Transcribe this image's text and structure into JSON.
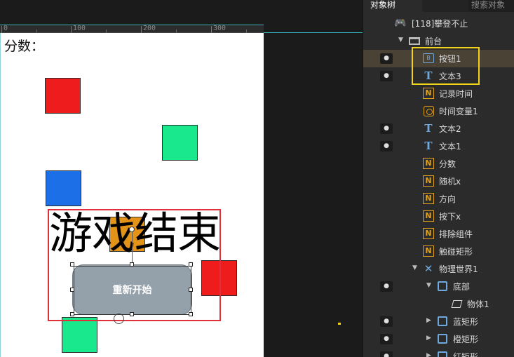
{
  "panel": {
    "tab_active": "对象树",
    "tab_search": "搜索对象",
    "tree": [
      {
        "label": "[118]攀登不止",
        "icon": "gamepad-icon",
        "eye": false,
        "arrow": ""
      },
      {
        "label": "前台",
        "icon": "stage-icon",
        "eye": false,
        "arrow": "▼"
      },
      {
        "label": "按钮1",
        "icon": "button-icon",
        "eye": true,
        "arrow": "",
        "highlighted": true
      },
      {
        "label": "文本3",
        "icon": "text-icon",
        "eye": true,
        "arrow": ""
      },
      {
        "label": "记录时间",
        "icon": "variable-icon",
        "eye": false,
        "arrow": ""
      },
      {
        "label": "时间变量1",
        "icon": "timer-icon",
        "eye": false,
        "arrow": ""
      },
      {
        "label": "文本2",
        "icon": "text-icon",
        "eye": true,
        "arrow": ""
      },
      {
        "label": "文本1",
        "icon": "text-icon",
        "eye": true,
        "arrow": ""
      },
      {
        "label": "分数",
        "icon": "variable-icon",
        "eye": false,
        "arrow": ""
      },
      {
        "label": "随机x",
        "icon": "variable-icon",
        "eye": false,
        "arrow": ""
      },
      {
        "label": "方向",
        "icon": "variable-icon",
        "eye": false,
        "arrow": ""
      },
      {
        "label": "按下x",
        "icon": "variable-icon",
        "eye": false,
        "arrow": ""
      },
      {
        "label": "排除组件",
        "icon": "variable-icon",
        "eye": false,
        "arrow": ""
      },
      {
        "label": "触碰矩形",
        "icon": "variable-icon",
        "eye": false,
        "arrow": ""
      },
      {
        "label": "物理世界1",
        "icon": "physics-icon",
        "eye": false,
        "arrow": "▼"
      },
      {
        "label": "底部",
        "icon": "layer-icon",
        "eye": true,
        "arrow": "▼"
      },
      {
        "label": "物体1",
        "icon": "body-icon",
        "eye": false,
        "arrow": ""
      },
      {
        "label": "蓝矩形",
        "icon": "layer-icon",
        "eye": true,
        "arrow": "▶"
      },
      {
        "label": "橙矩形",
        "icon": "layer-icon",
        "eye": true,
        "arrow": "▶"
      },
      {
        "label": "红矩形",
        "icon": "layer-icon",
        "eye": true,
        "arrow": "▶"
      }
    ]
  },
  "stage": {
    "ruler_labels": [
      "0",
      "100",
      "200",
      "300"
    ],
    "score_label": "分数：",
    "gameover_text": "游戏结束",
    "restart_label": "重新开始"
  },
  "colors": {
    "red": "#ee1c1c",
    "green": "#19e88c",
    "blue": "#1d6fe8",
    "orange": "#e39418",
    "button": "#94a0aa",
    "selection": "#f2d21b",
    "bounds": "#e0303a"
  }
}
